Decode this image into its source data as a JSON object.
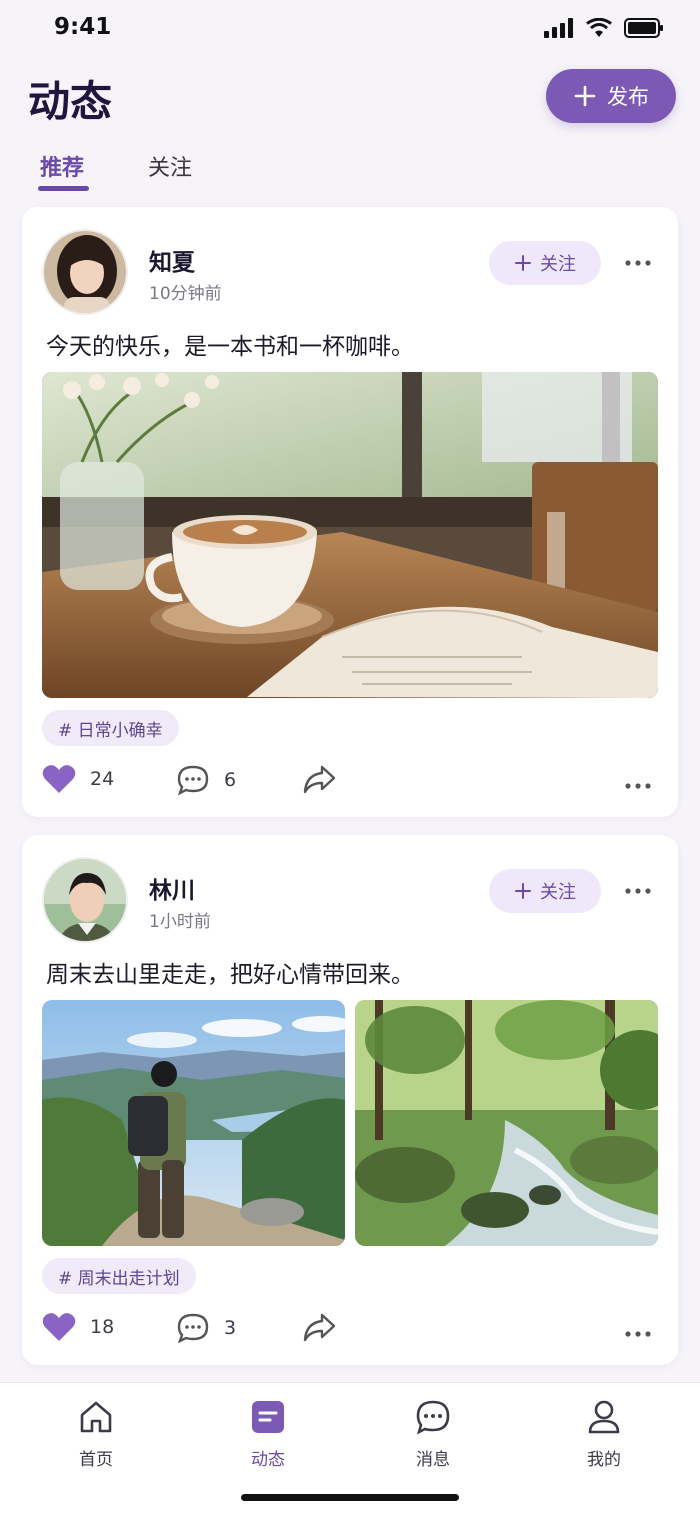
{
  "status": {
    "time": "9:41"
  },
  "header": {
    "title": "动态",
    "publish_label": "发布"
  },
  "tabs": [
    {
      "label": "推荐",
      "active": true
    },
    {
      "label": "关注",
      "active": false
    }
  ],
  "posts": [
    {
      "author": "知夏",
      "time": "10分钟前",
      "follow_label": "关注",
      "text": "今天的快乐，是一本书和一杯咖啡。",
      "tag": "# 日常小确幸",
      "likes": "24",
      "comments": "6"
    },
    {
      "author": "林川",
      "time": "1小时前",
      "follow_label": "关注",
      "text": "周末去山里走走，把好心情带回来。",
      "tag": "# 周末出走计划",
      "likes": "18",
      "comments": "3"
    }
  ],
  "bottom_nav": [
    {
      "label": "首页",
      "icon": "home-icon",
      "active": false
    },
    {
      "label": "动态",
      "icon": "feed-icon",
      "active": true
    },
    {
      "label": "消息",
      "icon": "message-icon",
      "active": false
    },
    {
      "label": "我的",
      "icon": "profile-icon",
      "active": false
    }
  ],
  "colors": {
    "accent": "#7b59b5",
    "accent_dark": "#6b4aa7",
    "tag_bg": "#f0eaf9",
    "like": "#8a64c4"
  }
}
